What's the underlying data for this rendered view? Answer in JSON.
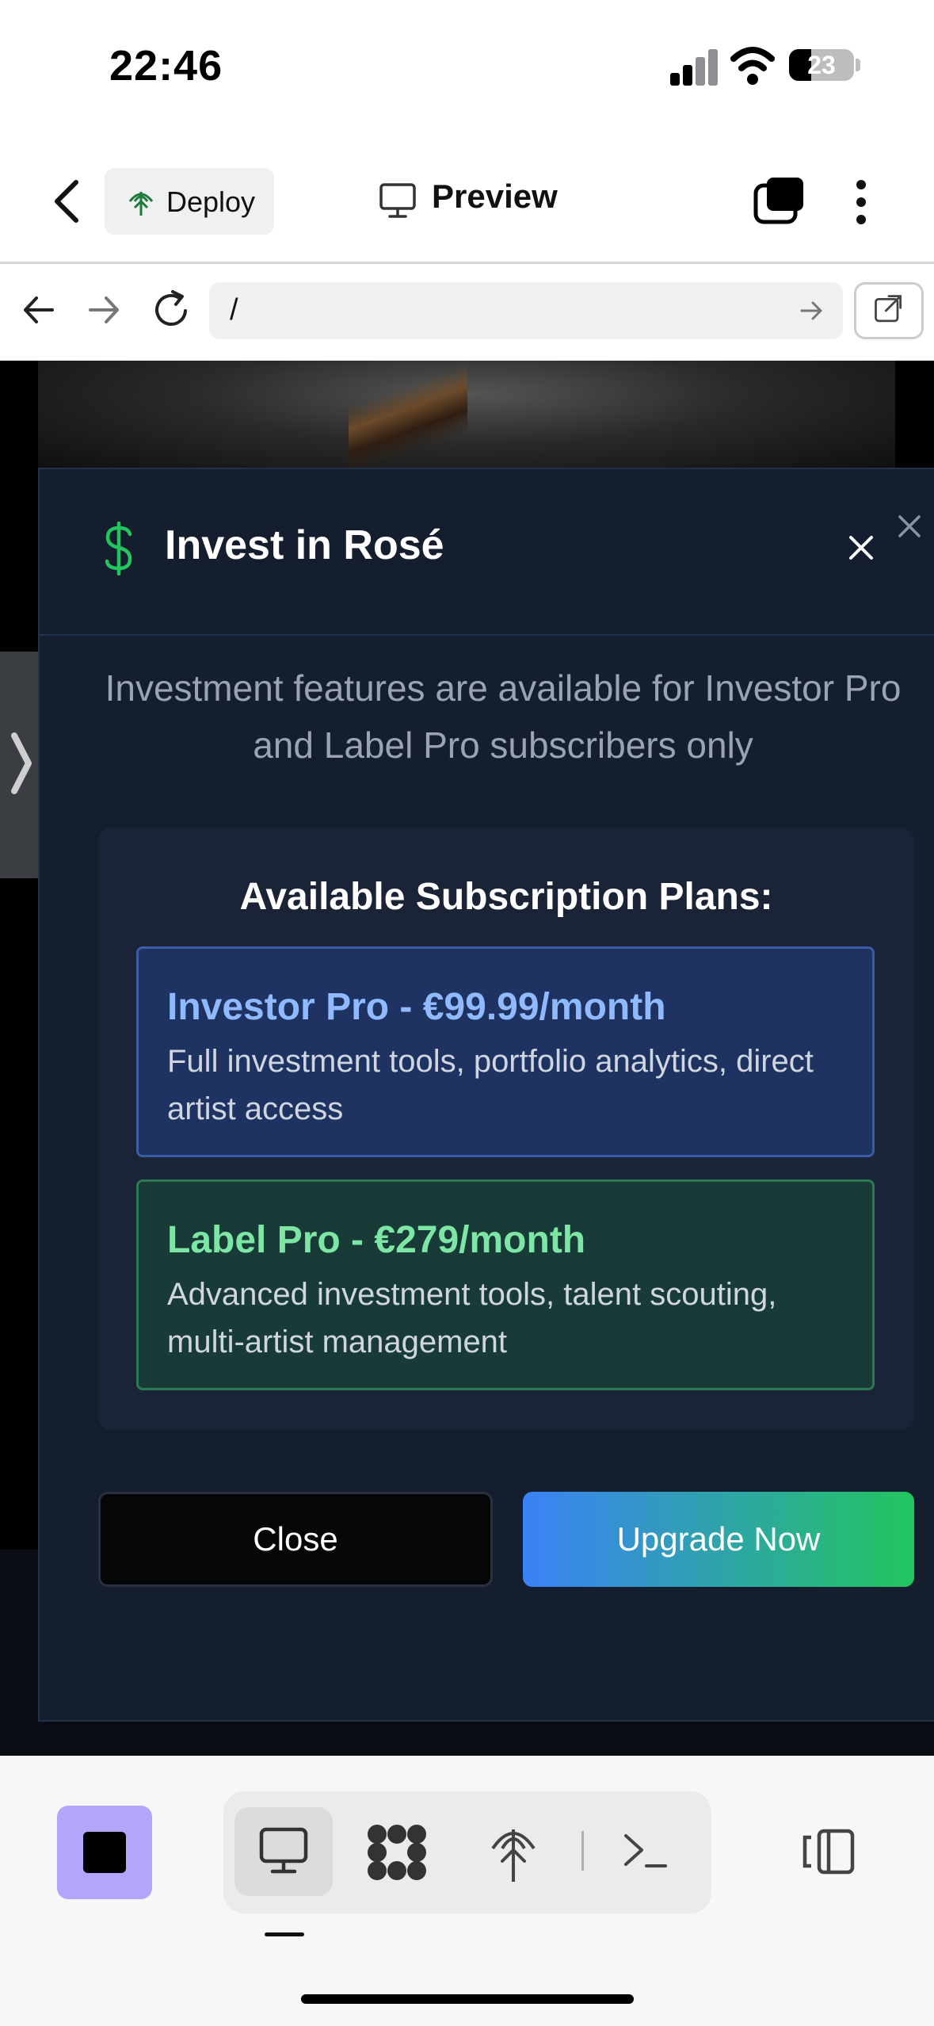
{
  "status_bar": {
    "time": "22:46",
    "battery_level": "23"
  },
  "app_bar": {
    "deploy_label": "Deploy",
    "preview_label": "Preview"
  },
  "url_bar": {
    "path": "/"
  },
  "modal": {
    "title": "Invest in Rosé",
    "description": "Investment features are available for Investor Pro and Label Pro subscribers only",
    "plans_heading": "Available Subscription Plans:",
    "plans": [
      {
        "name": "Investor Pro - €99.99/month",
        "description": "Full investment tools, portfolio analytics, direct artist access"
      },
      {
        "name": "Label Pro - €279/month",
        "description": "Advanced investment tools, talent scouting, multi-artist management"
      }
    ],
    "close_label": "Close",
    "upgrade_label": "Upgrade Now"
  },
  "colors": {
    "modal_bg": "#151e2e",
    "accent_green": "#22c55e",
    "accent_blue": "#3b82f6",
    "investor_plan": "#8fbaff",
    "label_plan": "#7de6a5",
    "stop_button": "#b5a4fb"
  },
  "icons": [
    "back-chevron",
    "deploy-globe",
    "monitor",
    "tabs",
    "more-vertical",
    "arrow-left",
    "arrow-right",
    "reload",
    "external-link",
    "dollar",
    "close-x",
    "side-panel-chevron",
    "stop",
    "monitor",
    "grid-blob",
    "deploy-globe",
    "terminal",
    "panel-toggle"
  ]
}
